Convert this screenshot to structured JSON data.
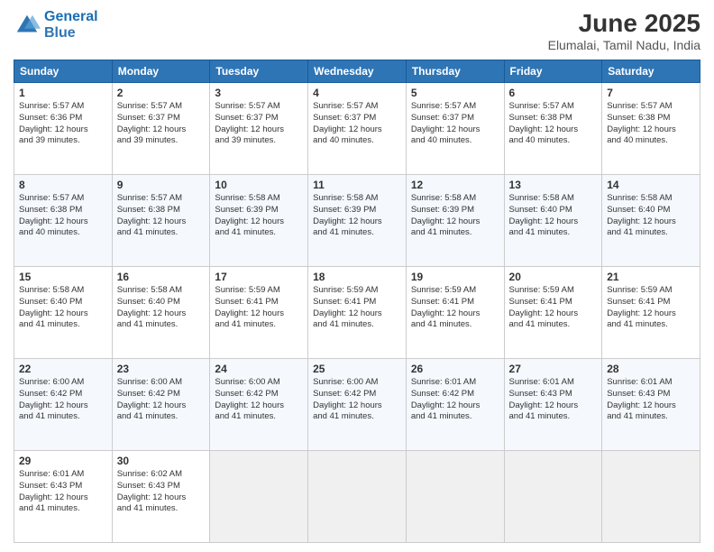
{
  "logo": {
    "line1": "General",
    "line2": "Blue"
  },
  "title": "June 2025",
  "subtitle": "Elumalai, Tamil Nadu, India",
  "headers": [
    "Sunday",
    "Monday",
    "Tuesday",
    "Wednesday",
    "Thursday",
    "Friday",
    "Saturday"
  ],
  "weeks": [
    [
      {
        "day": "1",
        "info": "Sunrise: 5:57 AM\nSunset: 6:36 PM\nDaylight: 12 hours\nand 39 minutes."
      },
      {
        "day": "2",
        "info": "Sunrise: 5:57 AM\nSunset: 6:37 PM\nDaylight: 12 hours\nand 39 minutes."
      },
      {
        "day": "3",
        "info": "Sunrise: 5:57 AM\nSunset: 6:37 PM\nDaylight: 12 hours\nand 39 minutes."
      },
      {
        "day": "4",
        "info": "Sunrise: 5:57 AM\nSunset: 6:37 PM\nDaylight: 12 hours\nand 40 minutes."
      },
      {
        "day": "5",
        "info": "Sunrise: 5:57 AM\nSunset: 6:37 PM\nDaylight: 12 hours\nand 40 minutes."
      },
      {
        "day": "6",
        "info": "Sunrise: 5:57 AM\nSunset: 6:38 PM\nDaylight: 12 hours\nand 40 minutes."
      },
      {
        "day": "7",
        "info": "Sunrise: 5:57 AM\nSunset: 6:38 PM\nDaylight: 12 hours\nand 40 minutes."
      }
    ],
    [
      {
        "day": "8",
        "info": "Sunrise: 5:57 AM\nSunset: 6:38 PM\nDaylight: 12 hours\nand 40 minutes."
      },
      {
        "day": "9",
        "info": "Sunrise: 5:57 AM\nSunset: 6:38 PM\nDaylight: 12 hours\nand 41 minutes."
      },
      {
        "day": "10",
        "info": "Sunrise: 5:58 AM\nSunset: 6:39 PM\nDaylight: 12 hours\nand 41 minutes."
      },
      {
        "day": "11",
        "info": "Sunrise: 5:58 AM\nSunset: 6:39 PM\nDaylight: 12 hours\nand 41 minutes."
      },
      {
        "day": "12",
        "info": "Sunrise: 5:58 AM\nSunset: 6:39 PM\nDaylight: 12 hours\nand 41 minutes."
      },
      {
        "day": "13",
        "info": "Sunrise: 5:58 AM\nSunset: 6:40 PM\nDaylight: 12 hours\nand 41 minutes."
      },
      {
        "day": "14",
        "info": "Sunrise: 5:58 AM\nSunset: 6:40 PM\nDaylight: 12 hours\nand 41 minutes."
      }
    ],
    [
      {
        "day": "15",
        "info": "Sunrise: 5:58 AM\nSunset: 6:40 PM\nDaylight: 12 hours\nand 41 minutes."
      },
      {
        "day": "16",
        "info": "Sunrise: 5:58 AM\nSunset: 6:40 PM\nDaylight: 12 hours\nand 41 minutes."
      },
      {
        "day": "17",
        "info": "Sunrise: 5:59 AM\nSunset: 6:41 PM\nDaylight: 12 hours\nand 41 minutes."
      },
      {
        "day": "18",
        "info": "Sunrise: 5:59 AM\nSunset: 6:41 PM\nDaylight: 12 hours\nand 41 minutes."
      },
      {
        "day": "19",
        "info": "Sunrise: 5:59 AM\nSunset: 6:41 PM\nDaylight: 12 hours\nand 41 minutes."
      },
      {
        "day": "20",
        "info": "Sunrise: 5:59 AM\nSunset: 6:41 PM\nDaylight: 12 hours\nand 41 minutes."
      },
      {
        "day": "21",
        "info": "Sunrise: 5:59 AM\nSunset: 6:41 PM\nDaylight: 12 hours\nand 41 minutes."
      }
    ],
    [
      {
        "day": "22",
        "info": "Sunrise: 6:00 AM\nSunset: 6:42 PM\nDaylight: 12 hours\nand 41 minutes."
      },
      {
        "day": "23",
        "info": "Sunrise: 6:00 AM\nSunset: 6:42 PM\nDaylight: 12 hours\nand 41 minutes."
      },
      {
        "day": "24",
        "info": "Sunrise: 6:00 AM\nSunset: 6:42 PM\nDaylight: 12 hours\nand 41 minutes."
      },
      {
        "day": "25",
        "info": "Sunrise: 6:00 AM\nSunset: 6:42 PM\nDaylight: 12 hours\nand 41 minutes."
      },
      {
        "day": "26",
        "info": "Sunrise: 6:01 AM\nSunset: 6:42 PM\nDaylight: 12 hours\nand 41 minutes."
      },
      {
        "day": "27",
        "info": "Sunrise: 6:01 AM\nSunset: 6:43 PM\nDaylight: 12 hours\nand 41 minutes."
      },
      {
        "day": "28",
        "info": "Sunrise: 6:01 AM\nSunset: 6:43 PM\nDaylight: 12 hours\nand 41 minutes."
      }
    ],
    [
      {
        "day": "29",
        "info": "Sunrise: 6:01 AM\nSunset: 6:43 PM\nDaylight: 12 hours\nand 41 minutes."
      },
      {
        "day": "30",
        "info": "Sunrise: 6:02 AM\nSunset: 6:43 PM\nDaylight: 12 hours\nand 41 minutes."
      },
      {
        "day": "",
        "info": ""
      },
      {
        "day": "",
        "info": ""
      },
      {
        "day": "",
        "info": ""
      },
      {
        "day": "",
        "info": ""
      },
      {
        "day": "",
        "info": ""
      }
    ]
  ]
}
